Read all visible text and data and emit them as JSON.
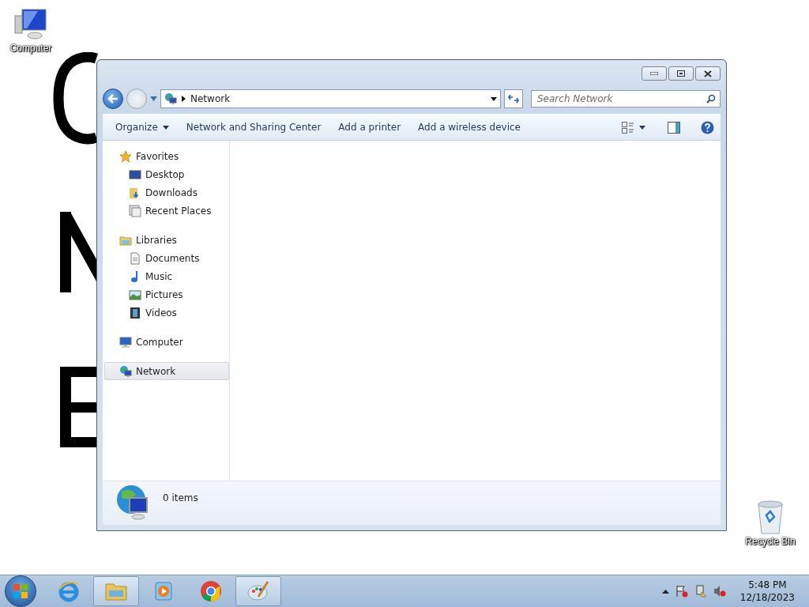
{
  "desktop": {
    "icons": [
      {
        "label": "Computer",
        "kind": "computer"
      },
      {
        "label": "Recycle Bin",
        "kind": "recycle"
      }
    ]
  },
  "window": {
    "address": {
      "crumbs": [
        "Network"
      ]
    },
    "search": {
      "placeholder": "Search Network"
    },
    "toolbar": [
      {
        "label": "Organize",
        "dropdown": true
      },
      {
        "label": "Network and Sharing Center",
        "dropdown": false
      },
      {
        "label": "Add a printer",
        "dropdown": false
      },
      {
        "label": "Add a wireless device",
        "dropdown": false
      }
    ],
    "nav": [
      {
        "label": "Favorites",
        "kind": "star",
        "selected": false,
        "children": [
          {
            "label": "Desktop",
            "kind": "desktop",
            "selected": false
          },
          {
            "label": "Downloads",
            "kind": "downloads",
            "selected": false
          },
          {
            "label": "Recent Places",
            "kind": "recent",
            "selected": false
          }
        ]
      },
      {
        "label": "Libraries",
        "kind": "libraries",
        "selected": false,
        "children": [
          {
            "label": "Documents",
            "kind": "documents",
            "selected": false
          },
          {
            "label": "Music",
            "kind": "music",
            "selected": false
          },
          {
            "label": "Pictures",
            "kind": "pictures",
            "selected": false
          },
          {
            "label": "Videos",
            "kind": "videos",
            "selected": false
          }
        ]
      },
      {
        "label": "Computer",
        "kind": "computer",
        "selected": false
      },
      {
        "label": "Network",
        "kind": "network",
        "selected": true
      }
    ],
    "status": {
      "text": "0 items"
    }
  },
  "taskbar": {
    "apps": [
      {
        "kind": "ie",
        "active": false
      },
      {
        "kind": "explorer",
        "active": true
      },
      {
        "kind": "media",
        "active": false
      },
      {
        "kind": "chrome",
        "active": false
      },
      {
        "kind": "paint",
        "active": true
      }
    ],
    "clock": {
      "time": "5:48 PM",
      "date": "12/18/2023"
    }
  }
}
